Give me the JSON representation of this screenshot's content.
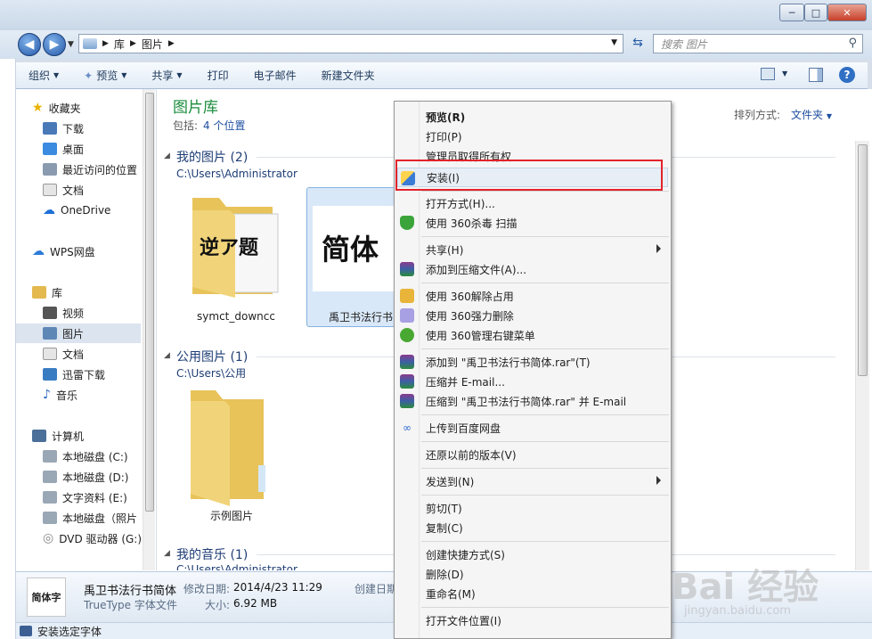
{
  "window": {
    "controls": {
      "minimize": "─",
      "maximize": "□",
      "close": "✕"
    }
  },
  "address": {
    "crumbs": [
      "库",
      "图片"
    ],
    "search_placeholder": "搜索 图片"
  },
  "toolbar": {
    "organize": "组织",
    "preview": "预览",
    "share": "共享",
    "print": "打印",
    "email": "电子邮件",
    "new_folder": "新建文件夹"
  },
  "nav": {
    "favorites": "收藏夹",
    "downloads": "下载",
    "desktop": "桌面",
    "recent": "最近访问的位置",
    "documents": "文档",
    "onedrive": "OneDrive",
    "wps": "WPS网盘",
    "libraries": "库",
    "videos": "视频",
    "pictures": "图片",
    "lib_docs": "文档",
    "thunder": "迅雷下载",
    "music": "音乐",
    "computer": "计算机",
    "disk_c": "本地磁盘 (C:)",
    "disk_d": "本地磁盘 (D:)",
    "disk_e": "文字资料 (E:)",
    "disk_f": "本地磁盘（照片",
    "dvd": "DVD 驱动器 (G:)"
  },
  "library": {
    "title": "图片库",
    "includes_label": "包括:",
    "includes_link": "4 个位置",
    "sort_label": "排列方式:",
    "sort_value": "文件夹",
    "groups": [
      {
        "title": "我的图片 (2)",
        "path": "C:\\Users\\Administrator",
        "items": [
          "symct_downcc",
          "禹卫书法行书"
        ]
      },
      {
        "title": "公用图片 (1)",
        "path": "C:\\Users\\公用",
        "items": [
          "示例图片"
        ]
      },
      {
        "title": "我的音乐 (1)",
        "path": "C:\\Users\\Administrator"
      }
    ],
    "thumb_text_1": "逆ア题",
    "thumb_text_2": "简体"
  },
  "details": {
    "thumb_text": "简体字",
    "name": "禹卫书法行书简体",
    "type": "TrueType 字体文件",
    "modified_label": "修改日期:",
    "modified_value": "2014/4/23 11:29",
    "size_label": "大小:",
    "size_value": "6.92 MB",
    "created_label": "创建日期"
  },
  "status": {
    "text": "安装选定字体"
  },
  "context_menu": {
    "preview": "预览(R)",
    "print": "打印(P)",
    "take_ownership": "管理员取得所有权",
    "install": "安装(I)",
    "open_with": "打开方式(H)...",
    "scan360": "使用 360杀毒 扫描",
    "share": "共享(H)",
    "add_archive": "添加到压缩文件(A)...",
    "unlock360": "使用 360解除占用",
    "force_delete360": "使用 360强力删除",
    "manage_menu360": "使用 360管理右键菜单",
    "add_rar": "添加到 \"禹卫书法行书简体.rar\"(T)",
    "compress_email": "压缩并 E-mail...",
    "compress_rar_email": "压缩到 \"禹卫书法行书简体.rar\" 并 E-mail",
    "upload_baidu": "上传到百度网盘",
    "restore": "还原以前的版本(V)",
    "send_to": "发送到(N)",
    "cut": "剪切(T)",
    "copy": "复制(C)",
    "create_shortcut": "创建快捷方式(S)",
    "delete": "删除(D)",
    "rename": "重命名(M)",
    "open_location": "打开文件位置(I)"
  },
  "watermark": {
    "text": "Bai 经验",
    "sub": "jingyan.baidu.com"
  },
  "colors": {
    "accent": "#1a8c3c",
    "link": "#1f4fa0",
    "highlight": "#e2232a"
  }
}
